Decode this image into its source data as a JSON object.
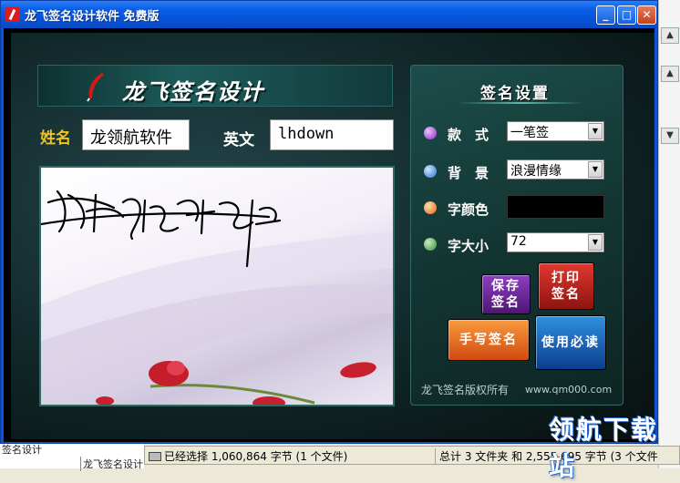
{
  "window": {
    "title": "龙飞签名设计软件  免费版"
  },
  "banner": {
    "title": "龙飞签名设计"
  },
  "name": {
    "label": "姓名",
    "value": "龙领航软件"
  },
  "english": {
    "label": "英文",
    "value": "lhdown"
  },
  "settings": {
    "title": "签名设置",
    "style_label": "款　式",
    "style_value": "一笔签",
    "background_label": "背　景",
    "background_value": "浪漫情缘",
    "color_label": "字颜色",
    "color_value": "#000000",
    "size_label": "字大小",
    "size_value": "72"
  },
  "buttons": {
    "save": "保存签名",
    "print": "打印签名",
    "handwrite": "手写签名",
    "must_read": "使用必读"
  },
  "footer": {
    "copyright": "龙飞签名版权所有",
    "site": "www.qm000.com"
  },
  "statusbar": {
    "selected": "已经选择 1,060,864 字节 (1 个文件)",
    "total": "总计 3 文件夹 和 2,555,695 字节 (3 个文件"
  },
  "background_window": {
    "item1": "签名设计",
    "item2": "龙飞签名设计"
  },
  "watermark": "领航下载站",
  "colors": {
    "title_blue": "#0553d6",
    "gold": "#f2c21c",
    "panel": "#133633"
  }
}
